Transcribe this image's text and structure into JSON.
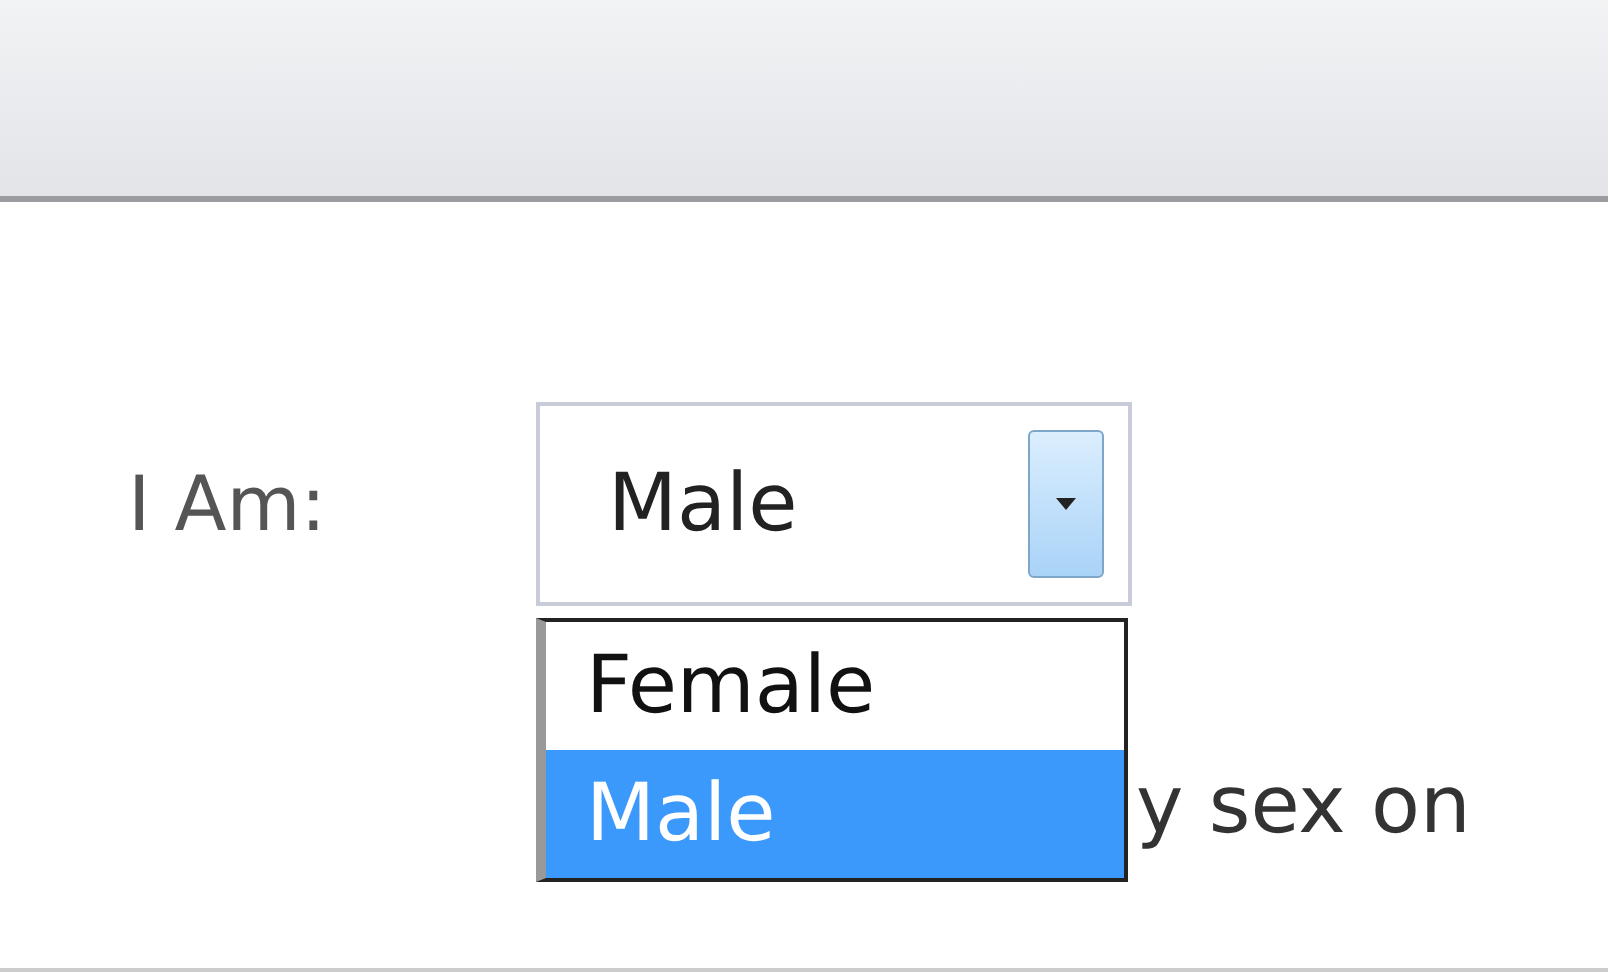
{
  "form": {
    "label": "I Am:",
    "select": {
      "value": "Male",
      "expanded": true
    },
    "options": [
      {
        "label": "Female",
        "selected": false
      },
      {
        "label": "Male",
        "selected": true
      }
    ],
    "note": "y sex on"
  }
}
